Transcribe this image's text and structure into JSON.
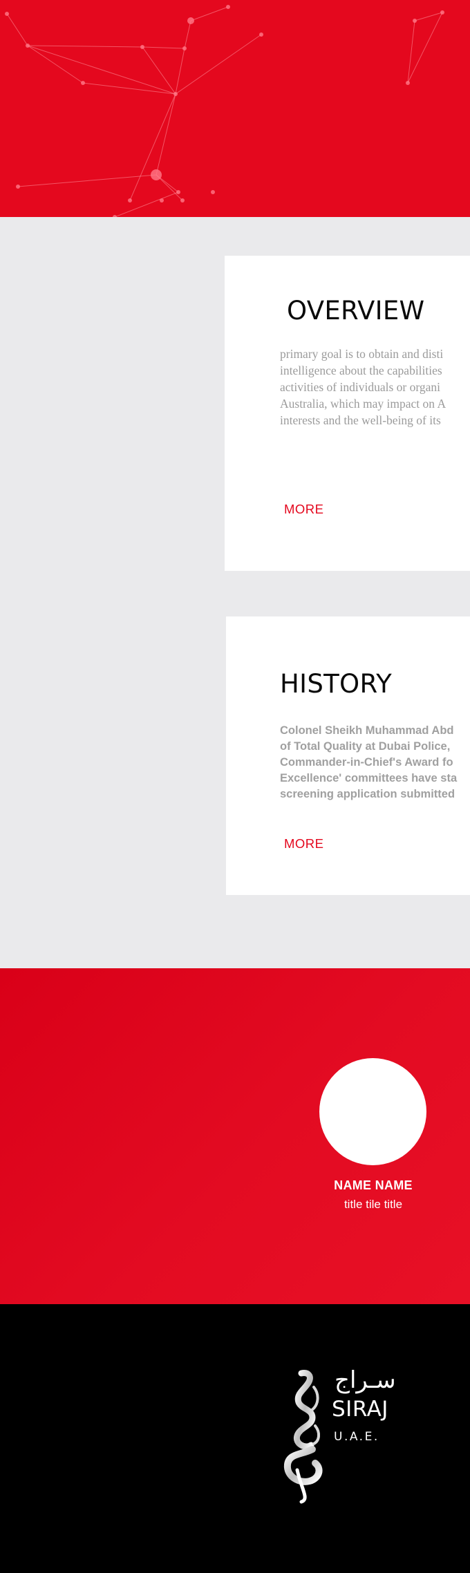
{
  "colors": {
    "brand_red": "#e4081e",
    "content_bg": "#eaeaec",
    "footer_bg": "#000000"
  },
  "overview": {
    "title": "OVERVIEW",
    "lines": [
      "primary goal is to obtain and disti",
      "intelligence about the capabilities",
      "activities of individuals or organi",
      "Australia, which may impact on A",
      "interests and the well-being of its"
    ],
    "more_label": "MORE"
  },
  "history": {
    "title": "HISTORY",
    "lines": [
      "Colonel Sheikh Muhammad Abd",
      "of Total Quality at Dubai Police,",
      "Commander-in-Chief's Award fo",
      "Excellence' committees have sta",
      "screening application submitted"
    ],
    "more_label": "MORE"
  },
  "team": {
    "member_name": "NAME NAME",
    "member_title": "title tile title"
  },
  "footer": {
    "logo_icon": "siraj-calligraphy-mark",
    "logo_arabic": "سـراج",
    "logo_name": "SIRAJ",
    "logo_region": "U.A.E."
  }
}
